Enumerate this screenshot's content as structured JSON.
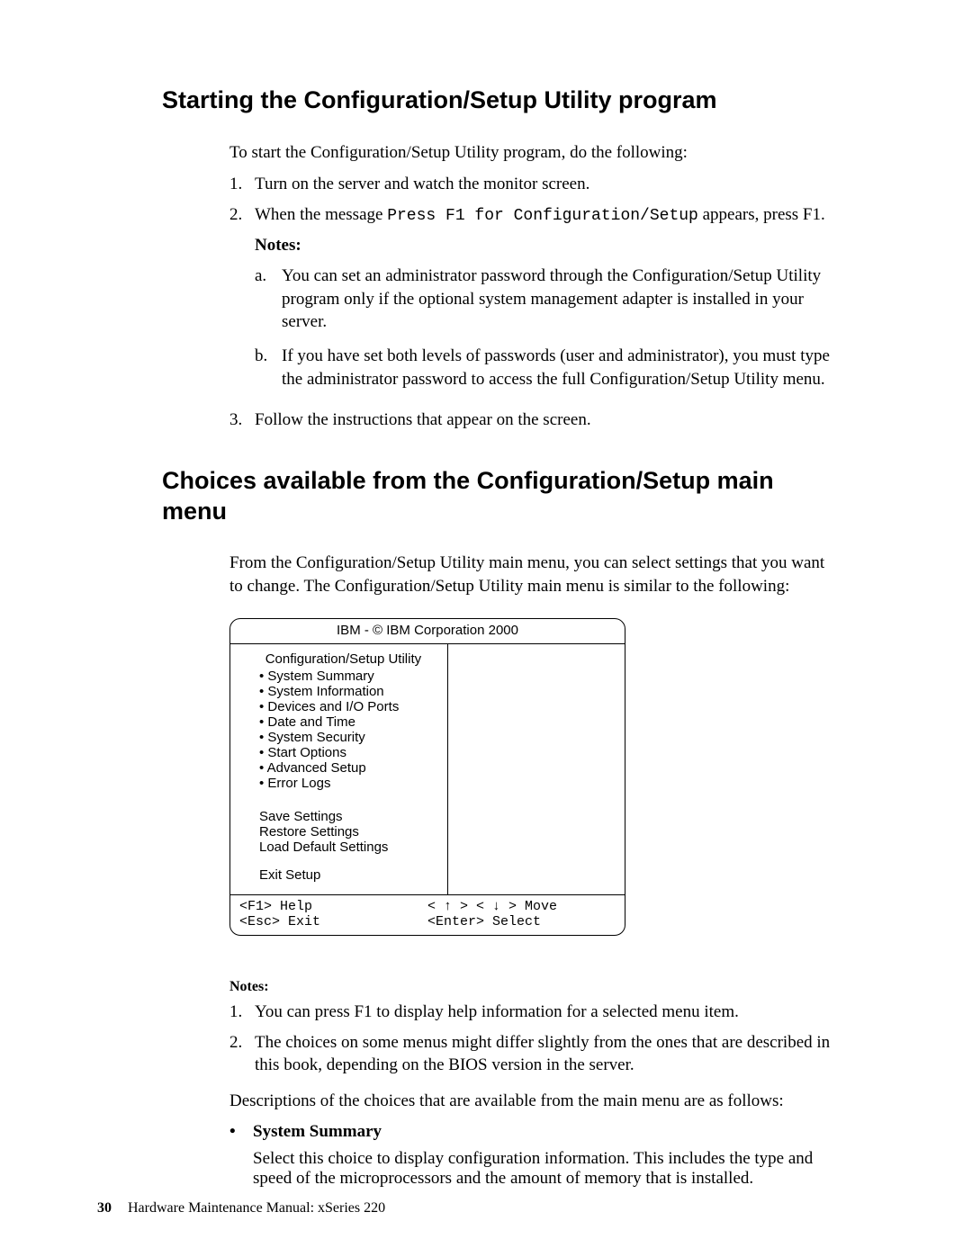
{
  "section1": {
    "title": "Starting the Configuration/Setup Utility program",
    "intro": "To start the Configuration/Setup Utility program, do the following:",
    "step1": "Turn on the server and watch the monitor screen.",
    "step2_pre": "When the message ",
    "step2_mono": "Press F1 for Configuration/Setup",
    "step2_post": " appears, press F1.",
    "notes_label": "Notes:",
    "note_a": "You can set an administrator password through the Configuration/Setup Utility program only if the optional system management adapter is installed in your server.",
    "note_b": "If you have set both levels of passwords (user and administrator), you must type the administrator password to access the full Configuration/Setup Utility menu.",
    "step3": "Follow the instructions that appear on the screen."
  },
  "section2": {
    "title": "Choices available from the Configuration/Setup main menu",
    "intro": "From the Configuration/Setup Utility main menu, you can select settings that you want to change. The Configuration/Setup Utility main menu is similar to the following:"
  },
  "bios": {
    "header": "IBM - © IBM Corporation  2000",
    "panel_title": "Configuration/Setup Utility",
    "menu": [
      "System Summary",
      "System Information",
      "Devices and I/O Ports",
      "Date and Time",
      "System Security",
      "Start Options",
      "Advanced Setup",
      "Error Logs"
    ],
    "actions": {
      "save": "Save Settings",
      "restore": "Restore Settings",
      "load": "Load Default Settings",
      "exit": "Exit Setup"
    },
    "footer": {
      "f1": "<F1>   Help",
      "esc": "<Esc> Exit",
      "move": "< ↑ > < ↓ >  Move",
      "select": "<Enter> Select"
    }
  },
  "section3": {
    "notes_label": "Notes:",
    "note1": "You can press F1 to display help information for a selected menu item.",
    "note2": "The choices on some menus might differ slightly from the ones that are described in this book, depending on the BIOS version in the server.",
    "desc_intro": "Descriptions of the choices that are available from the main menu are as follows:",
    "item1_title": "System Summary",
    "item1_body": "Select this choice to display configuration information. This includes the type and speed of the microprocessors and the amount of memory that is installed."
  },
  "footer": {
    "page": "30",
    "book": "Hardware Maintenance Manual: xSeries 220"
  },
  "markers": {
    "m1": "1.",
    "m2": "2.",
    "m3": "3.",
    "ma": "a.",
    "mb": "b.",
    "bullet": "•"
  }
}
